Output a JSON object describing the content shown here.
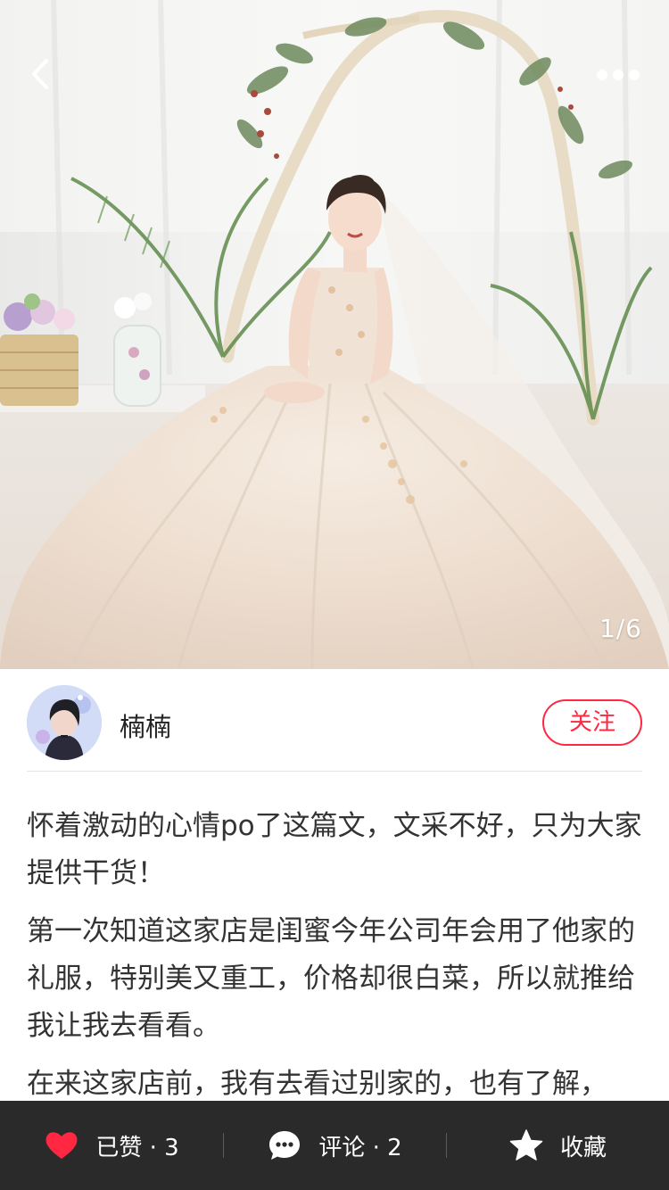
{
  "header": {
    "back_icon": "chevron-left-icon",
    "more_icon": "more-horizontal-icon"
  },
  "gallery": {
    "indicator": "1/6"
  },
  "author": {
    "name": "楠楠",
    "follow_label": "关注"
  },
  "article": {
    "paragraphs": [
      "怀着激动的心情po了这篇文，文采不好，只为大家提供干货！",
      "第一次知道这家店是闺蜜今年公司年会用了他家的礼服，特别美又重工，价格却很白菜，所以就推给我让我去看看。",
      "在来这家店前，我有去看过别家的，也有了解，"
    ]
  },
  "bottom_bar": {
    "like_label": "已赞 · 3",
    "comment_label": "评论 · 2",
    "favorite_label": "收藏"
  },
  "colors": {
    "accent": "#ff2741",
    "like_heart": "#ff2741",
    "bottom_bar_bg": "#2a2a2a"
  }
}
